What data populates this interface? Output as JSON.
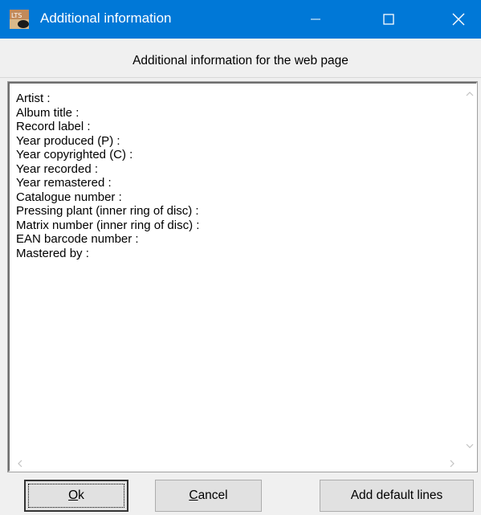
{
  "window": {
    "title": "Additional information",
    "app_icon_text": "LTS"
  },
  "dialog": {
    "heading": "Additional information for the web page"
  },
  "memo": {
    "lines": [
      "Artist :",
      "Album title :",
      "Record label :",
      "Year produced (P) :",
      "Year copyrighted (C) :",
      "Year recorded :",
      "Year remastered :",
      "Catalogue number :",
      "Pressing plant (inner ring of disc) :",
      "Matrix number (inner ring of disc) :",
      "EAN barcode number :",
      "Mastered by :"
    ]
  },
  "buttons": {
    "ok": {
      "mnemonic": "O",
      "rest": "k"
    },
    "cancel": {
      "mnemonic": "C",
      "rest": "ancel"
    },
    "add_default": {
      "label": "Add default lines"
    }
  },
  "colors": {
    "titlebar": "#0078d7",
    "dialog_bg": "#f0f0f0",
    "button_bg": "#e1e1e1"
  },
  "icons": {
    "app": "lts-app-icon",
    "minimize": "minimize-icon",
    "maximize": "maximize-icon",
    "close": "close-icon",
    "scroll_up": "chevron-up-icon",
    "scroll_down": "chevron-down-icon",
    "scroll_left": "chevron-left-icon",
    "scroll_right": "chevron-right-icon"
  }
}
